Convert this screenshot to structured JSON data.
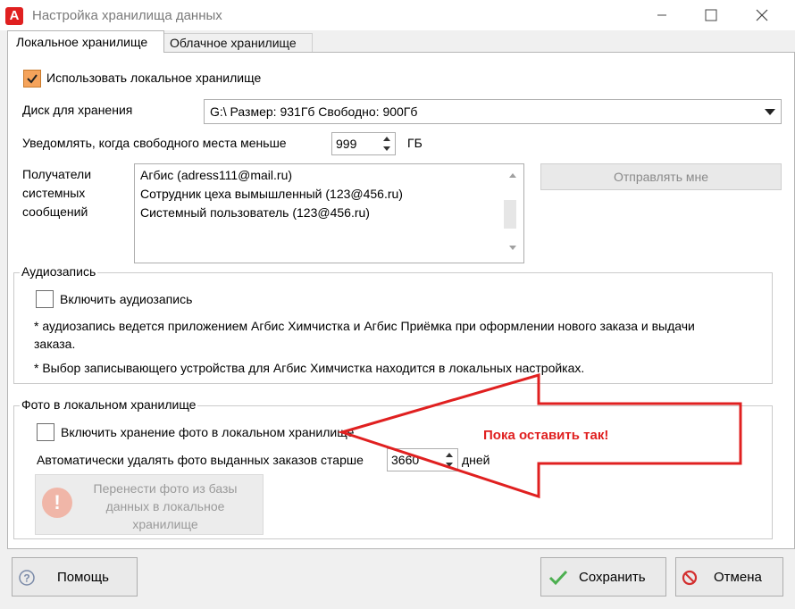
{
  "window": {
    "title": "Настройка хранилища данных",
    "logo_letter": "A",
    "minimize_icon": "minimize-icon",
    "maximize_icon": "maximize-icon",
    "close_icon": "close-icon"
  },
  "tabs": [
    {
      "label": "Локальное хранилище",
      "active": true
    },
    {
      "label": "Облачное хранилище",
      "active": false
    }
  ],
  "local": {
    "use_local_label": "Использовать локальное хранилище",
    "use_local_checked": true,
    "disk_label": "Диск для хранения",
    "disk_value": "G:\\ Размер: 931Гб Свободно: 900Гб",
    "notify_label": "Уведомлять, когда свободного места меньше",
    "notify_value": "999",
    "notify_unit": "ГБ",
    "recipients_label_lines": [
      "Получатели",
      "системных",
      "сообщений"
    ],
    "recipients": [
      "Агбис (adress111@mail.ru)",
      "Сотрудник цеха вымышленный (123@456.ru)",
      "Системный пользователь (123@456.ru)"
    ],
    "send_me_label": "Отправлять мне"
  },
  "audio": {
    "group_title": "Аудиозапись",
    "enable_label": "Включить аудиозапись",
    "enable_checked": false,
    "note1_line1": "* аудиозапись ведется приложением Агбис Химчистка и Агбис Приёмка при оформлении нового заказа и выдачи",
    "note1_line2": "заказа.",
    "note2": "* Выбор записывающего устройства для Агбис Химчистка находится в локальных настройках."
  },
  "photos": {
    "group_title": "Фото в локальном хранилище",
    "enable_label": "Включить хранение фото в локальном хранилище",
    "enable_checked": false,
    "auto_delete_label": "Автоматически удалять фото выданных заказов старше",
    "auto_delete_value": "3660",
    "auto_delete_unit": "дней",
    "move_label": "Перенести фото из базы данных в локальное хранилище",
    "move_icon": "warning-icon",
    "move_icon_glyph": "!"
  },
  "annotation": {
    "text": "Пока оставить так!",
    "color": "#e02020"
  },
  "buttons": {
    "help": "Помощь",
    "save": "Сохранить",
    "cancel": "Отмена"
  },
  "colors": {
    "checkbox_checked": "#f5a35b",
    "annotation_arrow": "#e02020"
  }
}
